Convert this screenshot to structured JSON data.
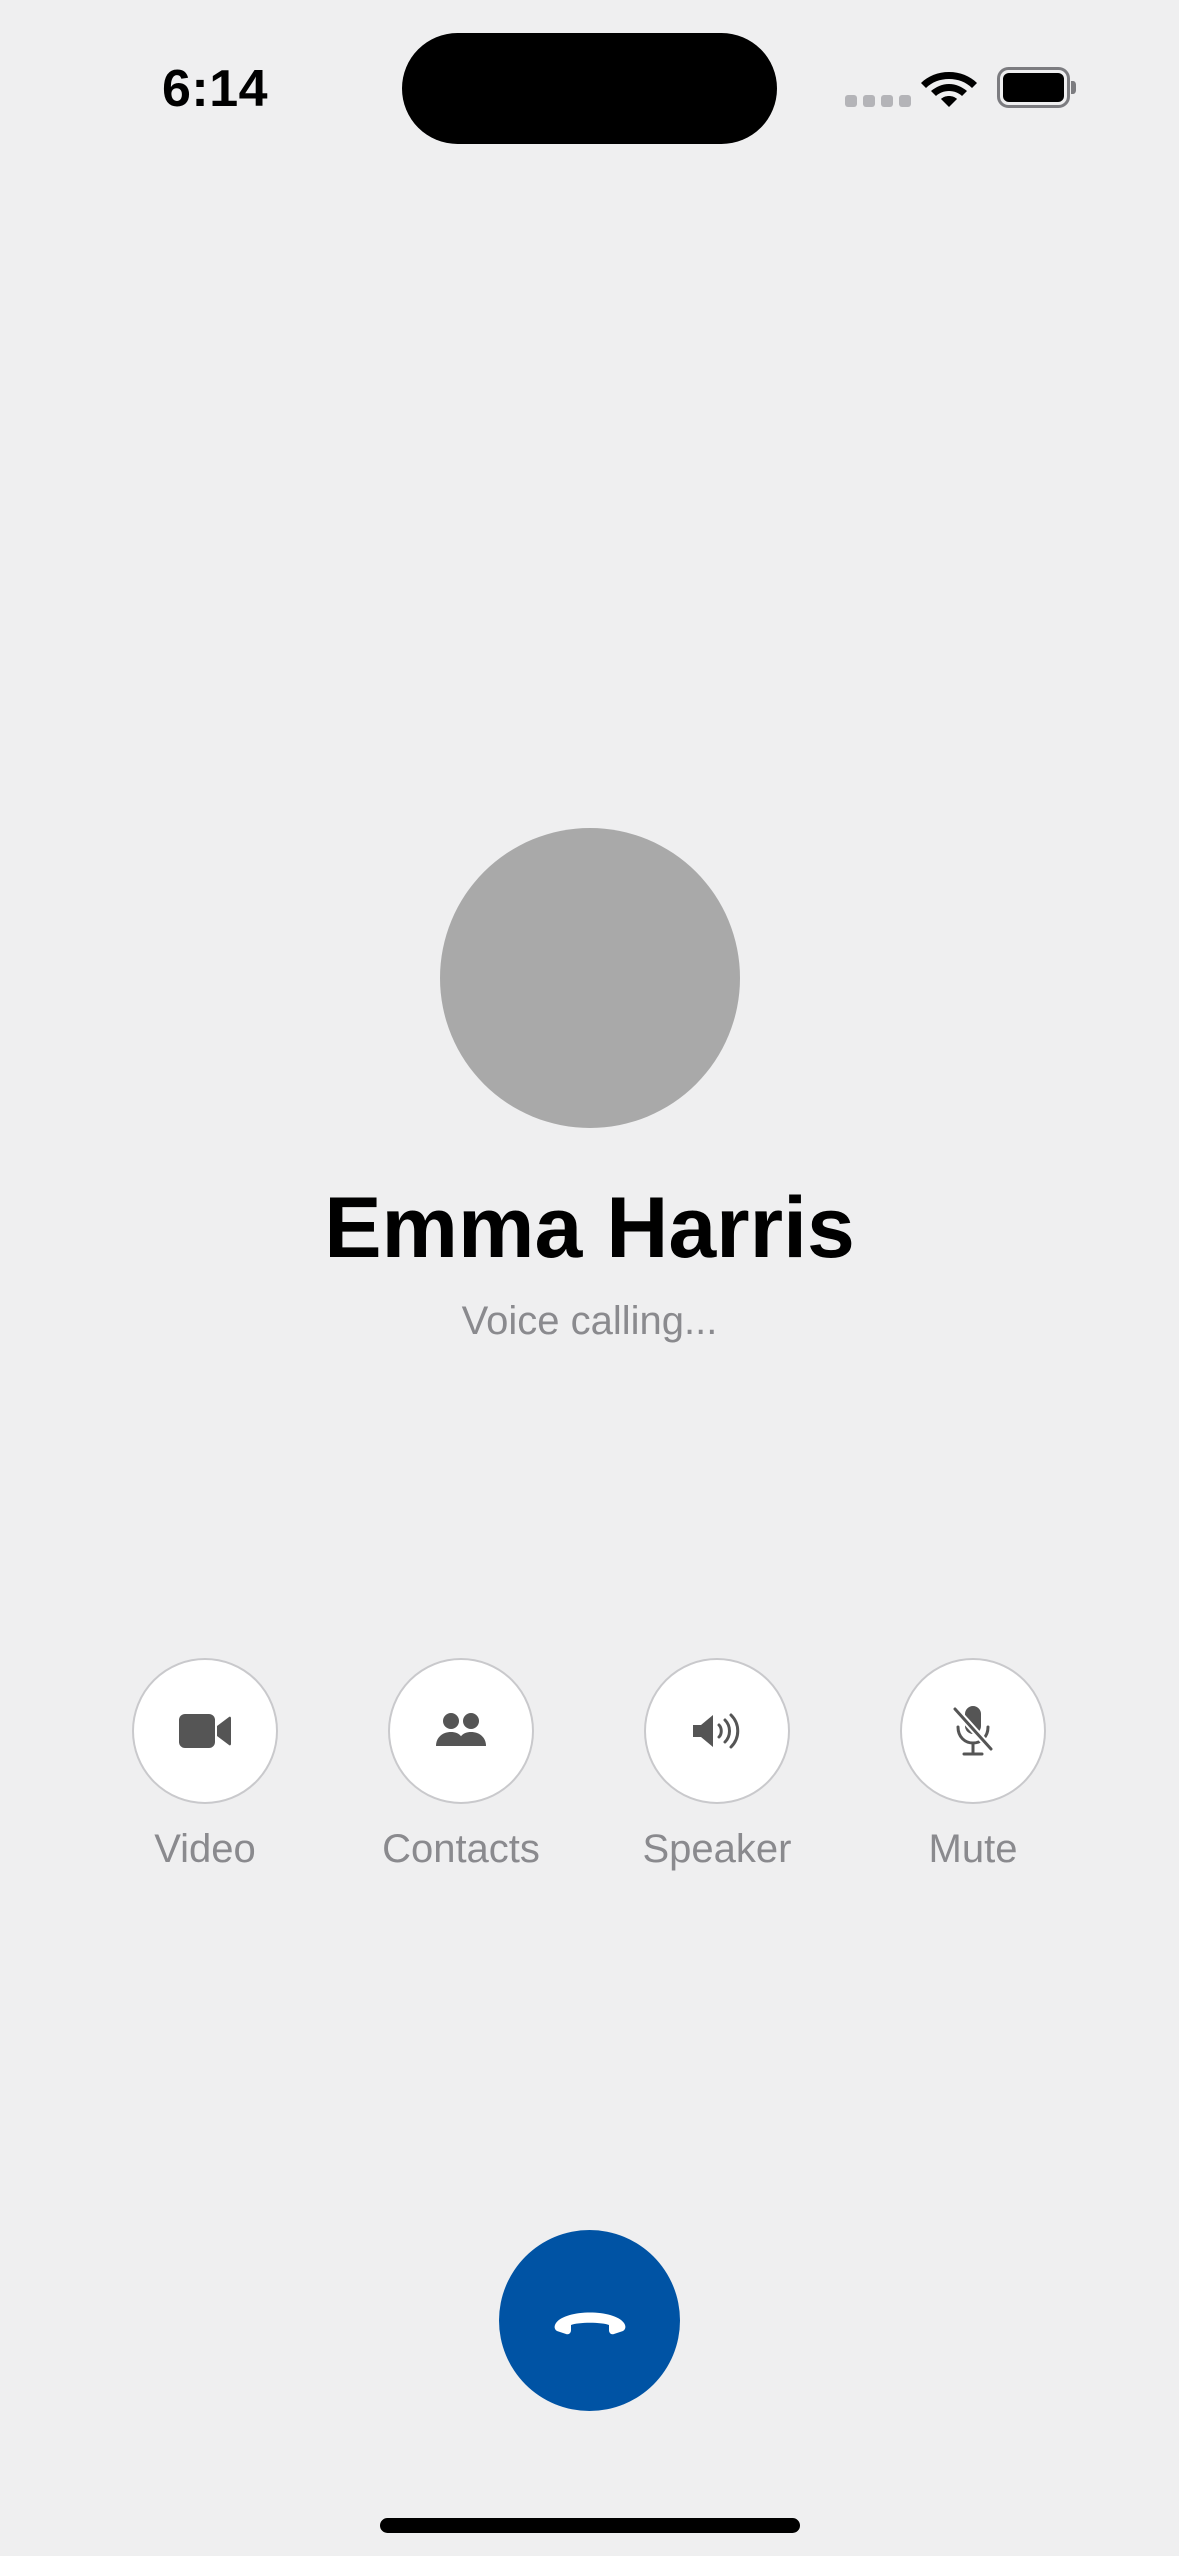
{
  "status_bar": {
    "time": "6:14"
  },
  "caller": {
    "name": "Emma Harris",
    "status": "Voice calling..."
  },
  "controls": [
    {
      "label": "Video",
      "icon": "video-camera-icon"
    },
    {
      "label": "Contacts",
      "icon": "people-icon"
    },
    {
      "label": "Speaker",
      "icon": "speaker-icon"
    },
    {
      "label": "Mute",
      "icon": "microphone-muted-icon"
    }
  ],
  "end_call": {
    "icon": "phone-hangup-icon"
  },
  "colors": {
    "background": "#efeff0",
    "avatar": "#a9a9a9",
    "end_call": "#0053a4",
    "secondary_text": "#8a8a8e",
    "icon": "#555555"
  }
}
